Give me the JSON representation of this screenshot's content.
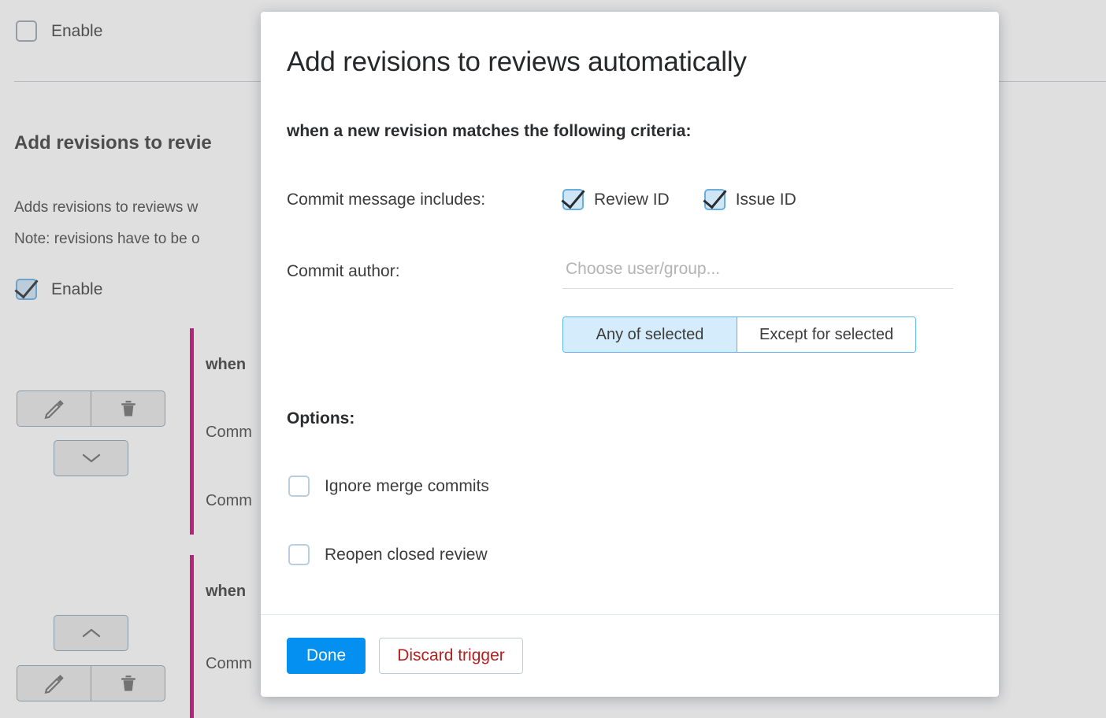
{
  "background": {
    "enable_top_label": "Enable",
    "section_title": "Add revisions to revie",
    "description_line1": "Adds revisions to reviews w",
    "description_line2": "Note: revisions have to be o",
    "enable_second_label": "Enable",
    "triggers": [
      {
        "when_label": "when",
        "line1": "Comm",
        "line2": "Comm",
        "edit_icon": "pencil-icon",
        "delete_icon": "trash-icon",
        "collapse_icon": "chevron-down-icon"
      },
      {
        "when_label": "when",
        "line1": "Comm",
        "expand_icon": "chevron-up-icon",
        "edit_icon": "pencil-icon",
        "delete_icon": "trash-icon"
      }
    ],
    "accent_bar_color": "#cc0077"
  },
  "modal": {
    "title": "Add revisions to reviews automatically",
    "criteria_heading": "when a new revision matches the following criteria:",
    "commit_message": {
      "label": "Commit message includes:",
      "checkboxes": [
        {
          "label": "Review ID",
          "checked": true
        },
        {
          "label": "Issue ID",
          "checked": true
        }
      ]
    },
    "commit_author": {
      "label": "Commit author:",
      "input_value": "",
      "input_placeholder": "Choose user/group...",
      "segmented": {
        "options": [
          "Any of selected",
          "Except for selected"
        ],
        "selected": "Any of selected"
      }
    },
    "options": {
      "heading": "Options:",
      "items": [
        {
          "label": "Ignore merge commits",
          "checked": false
        },
        {
          "label": "Reopen closed review",
          "checked": false
        }
      ]
    },
    "footer": {
      "done_label": "Done",
      "discard_label": "Discard trigger"
    },
    "colors": {
      "primary": "#0390f0",
      "danger": "#b5201f",
      "checkbox_checked_fill": "#cfe6f7",
      "segment_active_fill": "#d4ecfb"
    }
  }
}
